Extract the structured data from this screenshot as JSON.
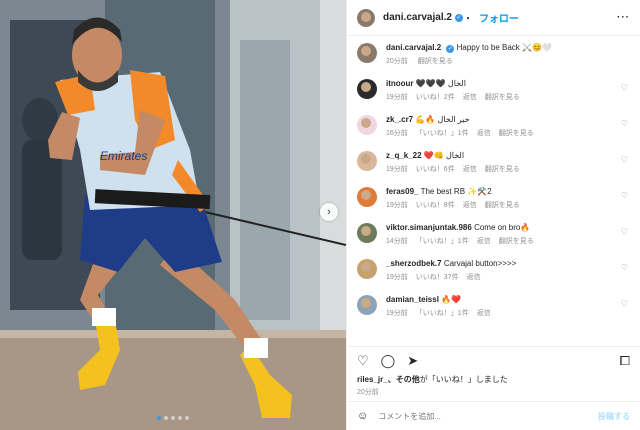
{
  "header": {
    "username": "dani.carvajal.2",
    "verified_icon": "verified-badge-icon",
    "follow_label": "フォロー",
    "more_icon": "more-dots-icon",
    "more_label": "···"
  },
  "photo": {
    "next_icon": "chevron-right-icon",
    "next_label": "›",
    "carousel_total": 5,
    "carousel_active": 1,
    "jersey_text": "Emirates"
  },
  "caption": {
    "username": "dani.carvajal.2",
    "text": "Happy to be Back ⚔️😊🤍",
    "time": "20分前",
    "translate": "翻訳を見る"
  },
  "comments": [
    {
      "username": "itnoour",
      "text": "🖤🖤🖤 الخال",
      "time": "19分前",
      "likes": "いいね！2件",
      "reply": "返信",
      "translate": "翻訳を見る"
    },
    {
      "username": "zk_.cr7",
      "text": "💪🔥 خير الخال",
      "time": "16分前",
      "likes": "「いいね！」1件",
      "reply": "返信",
      "translate": "翻訳を見る"
    },
    {
      "username": "z_q_k_22",
      "text": "❤️👊 الخال",
      "time": "19分前",
      "likes": "いいね！6件",
      "reply": "返信",
      "translate": "翻訳を見る"
    },
    {
      "username": "feras09_",
      "text": "The best RB ✨⚒️2",
      "time": "19分前",
      "likes": "いいね！8件",
      "reply": "返信",
      "translate": "翻訳を見る"
    },
    {
      "username": "viktor.simanjuntak.986",
      "text": "Come on bro🔥",
      "time": "14分前",
      "likes": "「いいね！」1件",
      "reply": "返信",
      "translate": "翻訳を見る"
    },
    {
      "username": "_sherzodbek.7",
      "text": "Carvajal button>>>>",
      "time": "19分前",
      "likes": "いいね！37件",
      "reply": "返信",
      "translate": ""
    },
    {
      "username": "damian_teissl",
      "text": "🔥❤️",
      "time": "19分前",
      "likes": "「いいね！」1件",
      "reply": "返信",
      "translate": ""
    }
  ],
  "heart_label": "♡",
  "actions": {
    "like_label": "♡",
    "comment_label": "◯",
    "share_label": "➤",
    "save_label": "⧠"
  },
  "likes_line": {
    "user": "riles_jr_",
    "suffix": "、その他",
    "tail": "が「いいね！」しました"
  },
  "post_time": "20分前",
  "add_comment": {
    "emoji_label": "☺",
    "placeholder": "コメントを追加...",
    "post_label": "投稿する"
  },
  "colors": {
    "accent": "#0095f6",
    "kit_orange": "#f28a2b",
    "kit_blue": "#1f3c88",
    "boot_yellow": "#f4c11e"
  }
}
